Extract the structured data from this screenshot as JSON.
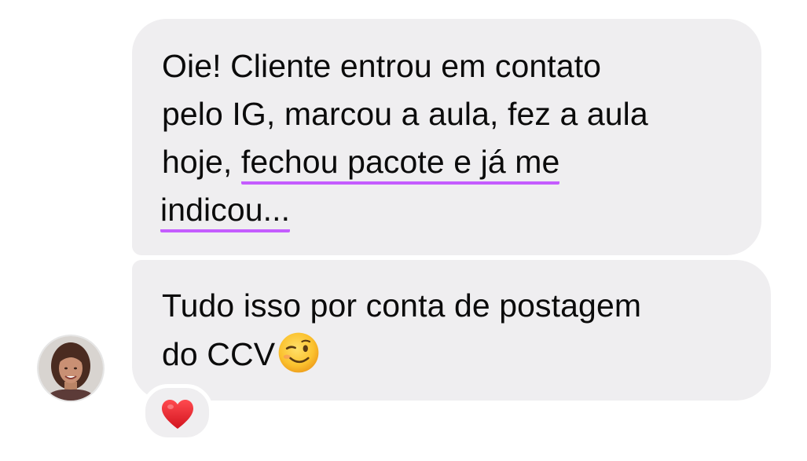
{
  "messages": [
    {
      "lines": [
        "Oie! Cliente entrou em contato",
        "pelo IG, marcou a aula, fez a aula",
        "hoje, ",
        "fechou pacote e já me",
        "indicou..."
      ]
    },
    {
      "lines": [
        "Tudo isso por conta de postagem",
        "do CCV"
      ],
      "emoji": "winking-face-icon"
    }
  ],
  "reaction": {
    "emoji": "red-heart-icon"
  },
  "colors": {
    "bubble": "#efeef0",
    "highlight_underline": "#c45cff",
    "text": "#0b0b0b",
    "heart": "#e8202a"
  }
}
